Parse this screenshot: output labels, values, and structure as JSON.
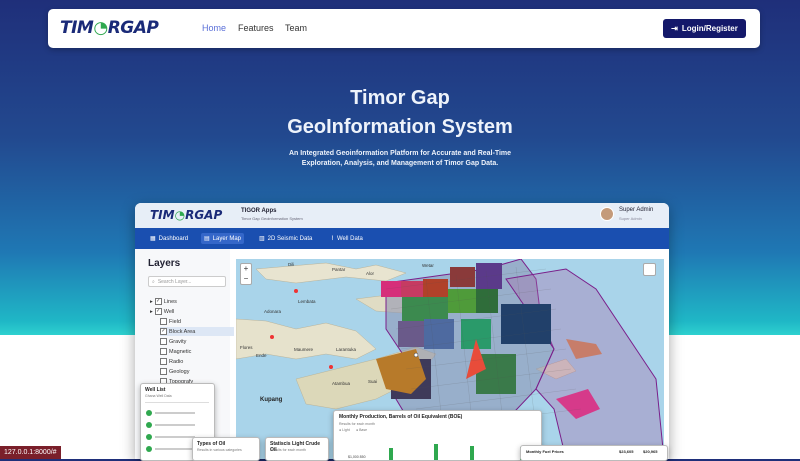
{
  "navbar": {
    "logo_left": "TIM",
    "logo_right": "RGAP",
    "links": [
      "Home",
      "Features",
      "Team"
    ],
    "login_label": "Login/Register"
  },
  "hero": {
    "title_line1": "Timor Gap",
    "title_line2": "GeoInformation System",
    "subtitle": "An Integrated Geoinformation Platform for Accurate and Real-Time Exploration, Analysis, and Management of Timor Gap Data."
  },
  "app": {
    "logo_left": "TIM",
    "logo_right": "RGAP",
    "name": "TIGOR Apps",
    "tagline": "Timor Gap Geoinformation System",
    "user_name": "Super Admin",
    "user_role": "Super Admin",
    "menu": [
      "Dashboard",
      "Layer Map",
      "2D Seismic Data",
      "Well Data"
    ],
    "sidebar": {
      "title": "Layers",
      "search_placeholder": "Search Layer...",
      "layers": [
        "Lines",
        "Well",
        "Field",
        "Block Area",
        "Gravity",
        "Magnetic",
        "Radio",
        "Geology",
        "Topografy"
      ]
    },
    "map": {
      "zoom_in": "+",
      "zoom_out": "−",
      "city_label": "Kupang",
      "place_labels": [
        "Dili",
        "Pantar",
        "Alor",
        "Wetar",
        "Lembata",
        "Adonara",
        "Flores",
        "Ende",
        "Maumere",
        "Larantuka",
        "Atambua",
        "Suai"
      ],
      "attribution": "Leaflet"
    },
    "cards": {
      "well_list_title": "Well List",
      "well_list_sub": "Ghana Well Data",
      "types_title": "Types of Oil",
      "types_sub": "Results in various categories",
      "crude_title": "Statiscis Light Crude Oil",
      "crude_sub": "Results for each month",
      "production_title": "Monthly Production, Barrels of Oil Equivalent (BOE)",
      "production_sub": "Results for each month",
      "legend": [
        "Light",
        "Base"
      ],
      "axis_hint": "$1,000   850",
      "fuel_title": "Monthly Fuel Prices",
      "fuel_values": [
        "$23,605",
        "$20,965"
      ]
    }
  },
  "status_url": "127.0.0.1:8000/#",
  "colors": {
    "brand_navy": "#14196a",
    "brand_green": "#2fa84f",
    "menu_blue": "#1a4fb0",
    "active_link": "#5a6fd8"
  }
}
